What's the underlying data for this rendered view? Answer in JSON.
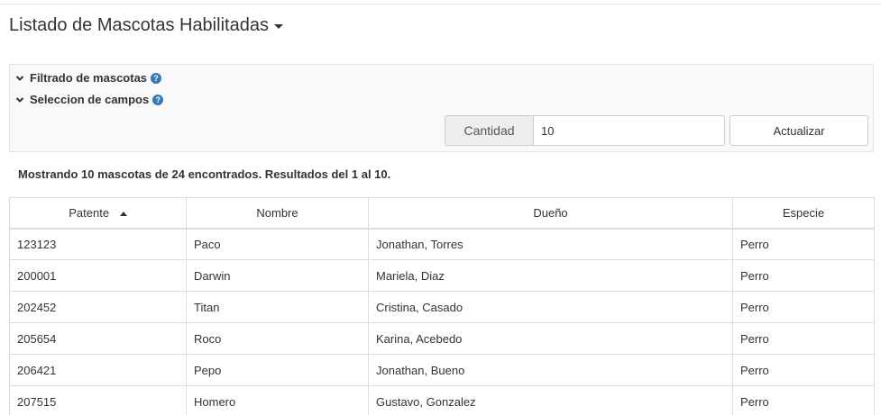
{
  "page": {
    "title": "Listado de Mascotas Habilitadas"
  },
  "filters": {
    "filter_toggle_label": "Filtrado de mascotas",
    "fields_toggle_label": "Seleccion de campos",
    "help_icon": "?",
    "quantity_label": "Cantidad",
    "quantity_value": "10",
    "update_label": "Actualizar"
  },
  "results": {
    "summary": "Mostrando 10 mascotas de 24 encontrados. Resultados del 1 al 10."
  },
  "table": {
    "columns": [
      "Patente",
      "Nombre",
      "Dueño",
      "Especie"
    ],
    "sorted_column": "Patente",
    "sort_direction": "asc",
    "rows": [
      [
        "123123",
        "Paco",
        "Jonathan, Torres",
        "Perro"
      ],
      [
        "200001",
        "Darwin",
        "Mariela, Diaz",
        "Perro"
      ],
      [
        "202452",
        "Titan",
        "Cristina, Casado",
        "Perro"
      ],
      [
        "205654",
        "Roco",
        "Karina, Acebedo",
        "Perro"
      ],
      [
        "206421",
        "Pepo",
        "Jonathan, Bueno",
        "Perro"
      ],
      [
        "207515",
        "Homero",
        "Gustavo, Gonzalez",
        "Perro"
      ]
    ]
  },
  "colors": {
    "help_icon": "#337ab7",
    "panel_background": "#f9f9f9",
    "border": "#dddddd"
  }
}
